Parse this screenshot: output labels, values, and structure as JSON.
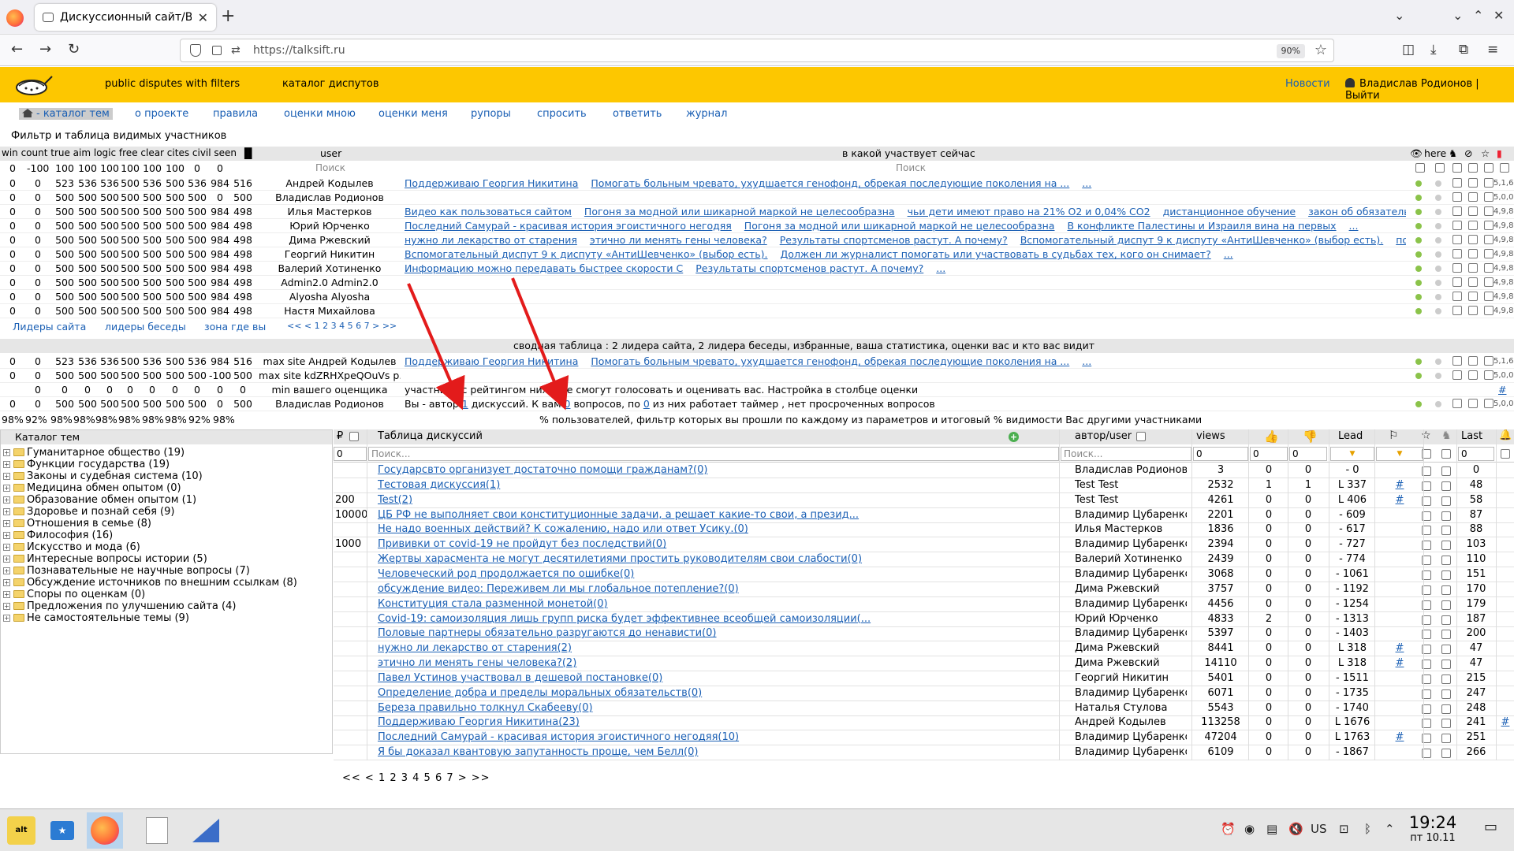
{
  "browser": {
    "tab_title": "Дискуссионный сайт/Выбо",
    "url": "https://talksift.ru",
    "zoom": "90%"
  },
  "site": {
    "slogan": "public disputes with filters",
    "catalog_link": "каталог диспутов",
    "news": "Новости",
    "user": "Владислав Родионов | Выйти",
    "nav": [
      "- каталог тем",
      "о проекте",
      "правила",
      "оценки мною",
      "оценки меня",
      "рупоры",
      "спросить",
      "ответить",
      "журнал"
    ]
  },
  "filter": {
    "title": "Фильтр и таблица видимых участников",
    "col_headers": "win count true aim logic free clear cites civil seen",
    "user_header": "user",
    "topic_header": "в какой участвует сейчас",
    "here_header": "here",
    "search_placeholder": "Поиск",
    "header_values": [
      "0",
      "-100",
      "100",
      "100",
      "100",
      "100",
      "100",
      "100",
      "0",
      "0"
    ],
    "rows": [
      {
        "v": [
          "0",
          "0",
          "523",
          "536",
          "536",
          "500",
          "536",
          "500",
          "536",
          "984",
          "516"
        ],
        "user": "Андрей Кодылев",
        "topics": [
          "Поддерживаю Георгия Никитина",
          "Помогать больным чревато, ухудшается генофонд, обрекая последующие поколения на ...",
          "..."
        ],
        "mini": "5,1,6"
      },
      {
        "v": [
          "0",
          "0",
          "500",
          "500",
          "500",
          "500",
          "500",
          "500",
          "500",
          "0",
          "500"
        ],
        "user": "Владислав Родионов",
        "topics": [],
        "mini": "5,0,0"
      },
      {
        "v": [
          "0",
          "0",
          "500",
          "500",
          "500",
          "500",
          "500",
          "500",
          "500",
          "984",
          "498"
        ],
        "user": "Илья Мастерков",
        "topics": [
          "Видео как пользоваться сайтом",
          "Погоня за модной или шикарной маркой не целесообразна",
          "чьи дети имеют право на 21% O2 и 0,04% CO2",
          "дистанционное обучение",
          "закон об обязательно...",
          "..."
        ],
        "mini": "4,9,8"
      },
      {
        "v": [
          "0",
          "0",
          "500",
          "500",
          "500",
          "500",
          "500",
          "500",
          "500",
          "984",
          "498"
        ],
        "user": "Юрий Юрченко",
        "topics": [
          "Последний Самурай - красивая история эгоистичного негодяя",
          "Погоня за модной или шикарной маркой не целесообразна",
          "В конфликте Палестины и Израиля вина на первых",
          "..."
        ],
        "mini": "4,9,8"
      },
      {
        "v": [
          "0",
          "0",
          "500",
          "500",
          "500",
          "500",
          "500",
          "500",
          "500",
          "984",
          "498"
        ],
        "user": "Дима Ржевский",
        "topics": [
          "нужно ли лекарство от старения",
          "этично ли менять гены человека?",
          "Результаты спортсменов растут. А почему?",
          "Вспомогательный диспут 9 к диспуту «АнтиШевченко» (выбор есть).",
          "появ...",
          "..."
        ],
        "mini": "4,9,8"
      },
      {
        "v": [
          "0",
          "0",
          "500",
          "500",
          "500",
          "500",
          "500",
          "500",
          "500",
          "984",
          "498"
        ],
        "user": "Георгий Никитин",
        "topics": [
          "Вспомогательный диспут 9 к диспуту «АнтиШевченко» (выбор есть).",
          "Должен ли журналист помогать или участвовать в судьбах тех, кого он снимает?",
          "..."
        ],
        "mini": "4,9,8"
      },
      {
        "v": [
          "0",
          "0",
          "500",
          "500",
          "500",
          "500",
          "500",
          "500",
          "500",
          "984",
          "498"
        ],
        "user": "Валерий Хотиненко",
        "topics": [
          "Информацию можно передавать быстрее скорости С",
          "Результаты спортсменов растут. А почему?",
          "..."
        ],
        "mini": "4,9,8"
      },
      {
        "v": [
          "0",
          "0",
          "500",
          "500",
          "500",
          "500",
          "500",
          "500",
          "500",
          "984",
          "498"
        ],
        "user": "Admin2.0 Admin2.0",
        "topics": [],
        "mini": "4,9,8"
      },
      {
        "v": [
          "0",
          "0",
          "500",
          "500",
          "500",
          "500",
          "500",
          "500",
          "500",
          "984",
          "498"
        ],
        "user": "Alyosha Alyosha",
        "topics": [],
        "mini": "4,9,8"
      },
      {
        "v": [
          "0",
          "0",
          "500",
          "500",
          "500",
          "500",
          "500",
          "500",
          "500",
          "984",
          "498"
        ],
        "user": "Настя Михайлова",
        "topics": [],
        "mini": "4,9,8"
      }
    ],
    "leaders": [
      "Лидеры сайта",
      "лидеры беседы",
      "зона где вы"
    ],
    "pager": [
      "<<",
      "<",
      "1",
      "2",
      "3",
      "4",
      "5",
      "6",
      "7",
      ">",
      ">>"
    ]
  },
  "summary": {
    "title": "сводная таблица : 2 лидера сайта, 2 лидера беседы, избранные, ваша статистика, оценки вас и кто вас видит",
    "rows": [
      {
        "v": [
          "0",
          "0",
          "523",
          "536",
          "536",
          "500",
          "536",
          "500",
          "536",
          "984",
          "516"
        ],
        "user": "max site Андрей Кодылев",
        "topics": [
          "Поддерживаю Георгия Никитина",
          "Помогать больным чревато, ухудшается генофонд, обрекая последующие поколения на ...",
          "..."
        ],
        "mini": "5,1,6"
      },
      {
        "v": [
          "0",
          "0",
          "500",
          "500",
          "500",
          "500",
          "500",
          "500",
          "500",
          "-100",
          "500"
        ],
        "user": "max site kdZRHXpeQOuVs p...",
        "topics": [],
        "mini": "5,0,0"
      },
      {
        "v": [
          "0",
          "0",
          "0",
          "0",
          "0",
          "0",
          "0",
          "0",
          "0",
          "0"
        ],
        "user": "min вашего оценщика",
        "text": "участники с рейтингом ниже не смогут голосовать и оценивать вас. Настройка в столбце оценки",
        "hash": "#"
      },
      {
        "v": [
          "0",
          "0",
          "500",
          "500",
          "500",
          "500",
          "500",
          "500",
          "500",
          "0",
          "500"
        ],
        "user": "Владислав Родионов",
        "text_a": "Вы - автор",
        "text_b": "1",
        "text_c": "дискуссий. К вам",
        "text_d": "0",
        "text_e": "вопросов, по",
        "text_f": "0",
        "text_g": "из них работает таймер , нет просроченных вопросов",
        "mini": "5,0,0"
      }
    ],
    "pct_values": [
      "98%",
      "92%",
      "98%",
      "98%",
      "98%",
      "98%",
      "98%",
      "98%",
      "92%",
      "98%"
    ],
    "pct_text": "% пользователей, фильтр которых вы прошли по каждому из параметров и итоговый % видимости Вас другими участниками"
  },
  "catalog": {
    "header": "Каталог тем",
    "items": [
      "Гуманитарное общество (19)",
      "Функции государства (19)",
      "Законы и судебная система (10)",
      "Медицина обмен опытом (0)",
      "Образование обмен опытом (1)",
      "Здоровье и познай себя (9)",
      "Отношения в семье (8)",
      "Философия (16)",
      "Искусство и мода (6)",
      "Интересные вопросы истории (5)",
      "Познавательные не научные вопросы (7)",
      "Обсуждение источников по внешним ссылкам (8)",
      "Споры по оценкам (0)",
      "Предложения по улучшению сайта (4)",
      "Не самостоятельные темы (9)"
    ]
  },
  "discussions": {
    "headers": {
      "p": "₽",
      "table": "Таблица дискуссий",
      "author": "автор/user",
      "views": "views",
      "lead": "Lead",
      "last": "Last"
    },
    "filters": {
      "p": "0",
      "search": "Поиск...",
      "author_search": "Поиск...",
      "views": "0",
      "likes": "0",
      "dislikes": "0",
      "last": "0"
    },
    "rows": [
      {
        "p": "",
        "title": "Государсвто организует достаточно помощи гражданам?(0)",
        "author": "Владислав Родионов",
        "views": "3",
        "likes": "0",
        "dislikes": "0",
        "lead": "- 0",
        "flag": "",
        "last": "0",
        "extra": ""
      },
      {
        "p": "",
        "title": "Тестовая дискуссия(1)",
        "author": "Test Test",
        "views": "2532",
        "likes": "1",
        "dislikes": "1",
        "lead": "L 337",
        "flag": "#",
        "last": "48",
        "extra": ""
      },
      {
        "p": "200",
        "title": "Test(2)",
        "author": "Test Test",
        "views": "4261",
        "likes": "0",
        "dislikes": "0",
        "lead": "L 406",
        "flag": "#",
        "last": "58",
        "extra": ""
      },
      {
        "p": "10000",
        "title": "ЦБ РФ не выполняет свои конституционные задачи, а решает какие-то свои, а презид...",
        "author": "Владимир Цубаренко",
        "views": "2201",
        "likes": "0",
        "dislikes": "0",
        "lead": "- 609",
        "flag": "",
        "last": "87",
        "extra": ""
      },
      {
        "p": "",
        "title": "Не надо военных действий? К сожалению, надо или ответ Усику.(0)",
        "author": "Илья Мастерков",
        "views": "1836",
        "likes": "0",
        "dislikes": "0",
        "lead": "- 617",
        "flag": "",
        "last": "88",
        "extra": ""
      },
      {
        "p": "1000",
        "title": "Прививки от covid-19 не пройдут без последствий(0)",
        "author": "Владимир Цубаренко",
        "views": "2394",
        "likes": "0",
        "dislikes": "0",
        "lead": "- 727",
        "flag": "",
        "last": "103",
        "extra": ""
      },
      {
        "p": "",
        "title": "Жертвы харасмента не могут десятилетиями простить руководителям свои слабости(0)",
        "author": "Валерий Хотиненко",
        "views": "2439",
        "likes": "0",
        "dislikes": "0",
        "lead": "- 774",
        "flag": "",
        "last": "110",
        "extra": ""
      },
      {
        "p": "",
        "title": "Человеческий род продолжается по ошибке(0)",
        "author": "Владимир Цубаренко",
        "views": "3068",
        "likes": "0",
        "dislikes": "0",
        "lead": "- 1061",
        "flag": "",
        "last": "151",
        "extra": ""
      },
      {
        "p": "",
        "title": "обсуждение видео: Переживем ли мы глобальное потепление?(0)",
        "author": "Дима Ржевский",
        "views": "3757",
        "likes": "0",
        "dislikes": "0",
        "lead": "- 1192",
        "flag": "",
        "last": "170",
        "extra": ""
      },
      {
        "p": "",
        "title": "Конституция стала разменной монетой(0)",
        "author": "Владимир Цубаренко",
        "views": "4456",
        "likes": "0",
        "dislikes": "0",
        "lead": "- 1254",
        "flag": "",
        "last": "179",
        "extra": ""
      },
      {
        "p": "",
        "title": "Covid-19: самоизоляция лишь групп риска будет эффективнее всеобщей самоизоляции(...",
        "author": "Юрий Юрченко",
        "views": "4833",
        "likes": "2",
        "dislikes": "0",
        "lead": "- 1313",
        "flag": "",
        "last": "187",
        "extra": ""
      },
      {
        "p": "",
        "title": "Половые партнеры обязательно разругаются до ненависти(0)",
        "author": "Владимир Цубаренко",
        "views": "5397",
        "likes": "0",
        "dislikes": "0",
        "lead": "- 1403",
        "flag": "",
        "last": "200",
        "extra": ""
      },
      {
        "p": "",
        "title": "нужно ли лекарство от старения(2)",
        "author": "Дима Ржевский",
        "views": "8441",
        "likes": "0",
        "dislikes": "0",
        "lead": "L 318",
        "flag": "#",
        "last": "47",
        "extra": ""
      },
      {
        "p": "",
        "title": "этично ли менять гены человека?(2)",
        "author": "Дима Ржевский",
        "views": "14110",
        "likes": "0",
        "dislikes": "0",
        "lead": "L 318",
        "flag": "#",
        "last": "47",
        "extra": ""
      },
      {
        "p": "",
        "title": "Павел Устинов участвовал в дешевой постановке(0)",
        "author": "Георгий Никитин",
        "views": "5401",
        "likes": "0",
        "dislikes": "0",
        "lead": "- 1511",
        "flag": "",
        "last": "215",
        "extra": ""
      },
      {
        "p": "",
        "title": "Определение добра и пределы моральных обязательств(0)",
        "author": "Владимир Цубаренко",
        "views": "6071",
        "likes": "0",
        "dislikes": "0",
        "lead": "- 1735",
        "flag": "",
        "last": "247",
        "extra": ""
      },
      {
        "p": "",
        "title": "Береза правильно толкнул Скабееву(0)",
        "author": "Наталья Стулова",
        "views": "5543",
        "likes": "0",
        "dislikes": "0",
        "lead": "- 1740",
        "flag": "",
        "last": "248",
        "extra": ""
      },
      {
        "p": "",
        "title": "Поддерживаю Георгия Никитина(23)",
        "author": "Андрей Кодылев",
        "views": "113258",
        "likes": "0",
        "dislikes": "0",
        "lead": "L 1676",
        "flag": "",
        "last": "241",
        "extra": "#"
      },
      {
        "p": "",
        "title": "Последний Самурай - красивая история эгоистичного негодяя(10)",
        "author": "Владимир Цубаренко",
        "views": "47204",
        "likes": "0",
        "dislikes": "0",
        "lead": "L 1763",
        "flag": "#",
        "last": "251",
        "extra": ""
      },
      {
        "p": "",
        "title": "Я бы доказал квантовую запутанность проще, чем Белл(0)",
        "author": "Владимир Цубаренко",
        "views": "6109",
        "likes": "0",
        "dislikes": "0",
        "lead": "- 1867",
        "flag": "",
        "last": "266",
        "extra": ""
      }
    ],
    "pager": "<< < 1 2 3 4 5 6 7 > >>"
  },
  "taskbar": {
    "lang": "US",
    "time": "19:24",
    "date": "пт 10.11"
  }
}
